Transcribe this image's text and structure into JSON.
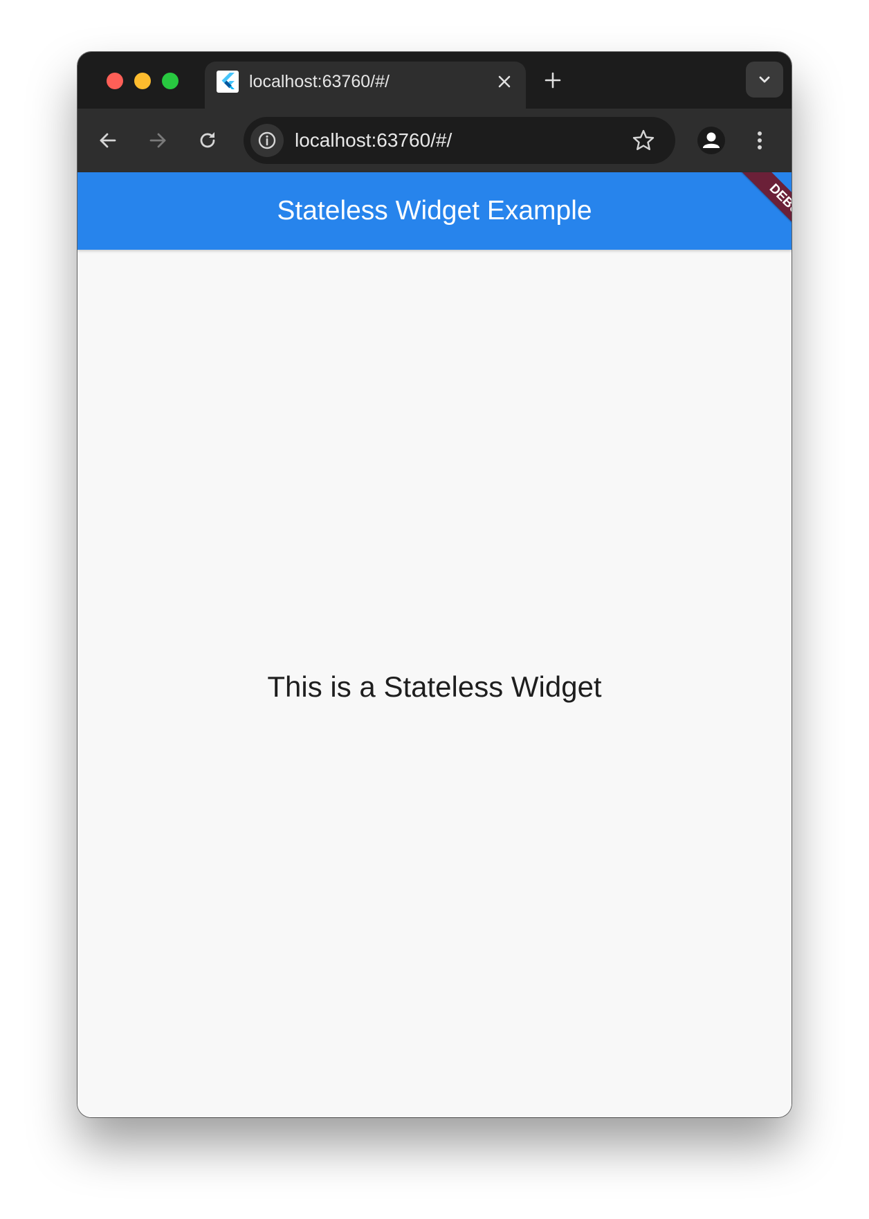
{
  "browser": {
    "tab": {
      "title": "localhost:63760/#/",
      "favicon": "flutter-logo-icon"
    },
    "toolbar": {
      "url": "localhost:63760/#/"
    },
    "icons": {
      "back": "arrow-left-icon",
      "forward": "arrow-right-icon",
      "reload": "reload-icon",
      "site_info": "info-icon",
      "bookmark": "star-icon",
      "profile": "person-icon",
      "menu": "kebab-menu-icon",
      "new_tab": "plus-icon",
      "tab_search": "chevron-down-icon",
      "close_tab": "close-icon"
    }
  },
  "app": {
    "appbar_title": "Stateless Widget Example",
    "debug_banner": "DEBUG",
    "body_text": "This is a Stateless Widget",
    "colors": {
      "appbar": "#2784ec",
      "debug_banner": "#6b2038",
      "background": "#f8f8f8"
    }
  }
}
